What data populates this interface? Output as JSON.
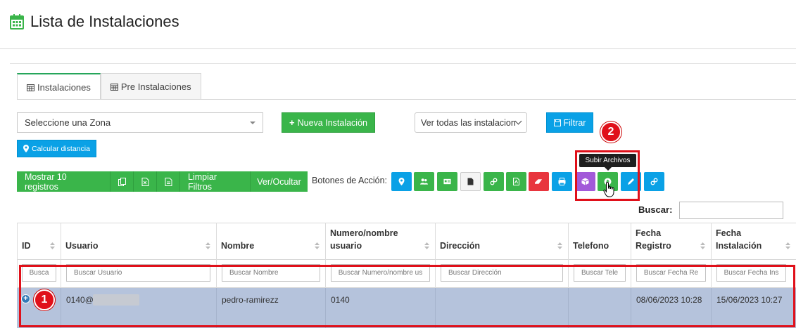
{
  "header": {
    "title": "Lista de Instalaciones"
  },
  "tabs": [
    {
      "label": "Instalaciones",
      "active": true
    },
    {
      "label": "Pre Instalaciones",
      "active": false
    }
  ],
  "filters": {
    "zone_select_value": "Seleccione una Zona",
    "new_installation_label": "Nueva Instalación",
    "view_select_value": "Ver todas las instalacion",
    "filter_label": "Filtrar",
    "calc_distance_label": "Calcular distancia"
  },
  "toolbar": {
    "show_records_label": "Mostrar 10 registros",
    "clear_filters_label": "Limpiar Filtros",
    "show_hide_label": "Ver/Ocultar",
    "action_buttons_label": "Botones de Acción:"
  },
  "tooltip": {
    "text": "Subir Archivos"
  },
  "annotations": {
    "badge_1": "1",
    "badge_2": "2"
  },
  "search": {
    "label": "Buscar:"
  },
  "table": {
    "columns": [
      {
        "label": "ID",
        "placeholder": "Busca"
      },
      {
        "label": "Usuario",
        "placeholder": "Buscar Usuario"
      },
      {
        "label": "Nombre",
        "placeholder": "Buscar Nombre"
      },
      {
        "label": "Numero/nombre usuario",
        "placeholder": "Buscar Numero/nombre us"
      },
      {
        "label": "Dirección",
        "placeholder": "Buscar Dirección"
      },
      {
        "label": "Telefono",
        "placeholder": "Buscar Tele"
      },
      {
        "label": "Fecha Registro",
        "placeholder": "Buscar Fecha Re"
      },
      {
        "label": "Fecha Instalación",
        "placeholder": "Buscar Fecha Ins"
      }
    ],
    "rows": [
      {
        "id": "",
        "usuario": "0140@",
        "nombre": "pedro-ramirezz",
        "numero": "0140",
        "direccion": "",
        "telefono": "",
        "fecha_registro": "08/06/2023 10:28",
        "fecha_instalacion": "15/06/2023 10:27"
      }
    ]
  },
  "colors": {
    "green": "#3ab54a",
    "blue": "#0aa1e6",
    "red_annotation": "#e0101a",
    "row_selected": "#b5c3dc",
    "purple": "#a259d9"
  },
  "action_icons": [
    "map-marker-icon",
    "users-icon",
    "id-card-icon",
    "file-icon",
    "link-icon",
    "file-pdf-icon",
    "eraser-icon",
    "print-icon",
    "cube-icon",
    "upload-icon",
    "pencil-icon",
    "link-icon"
  ]
}
